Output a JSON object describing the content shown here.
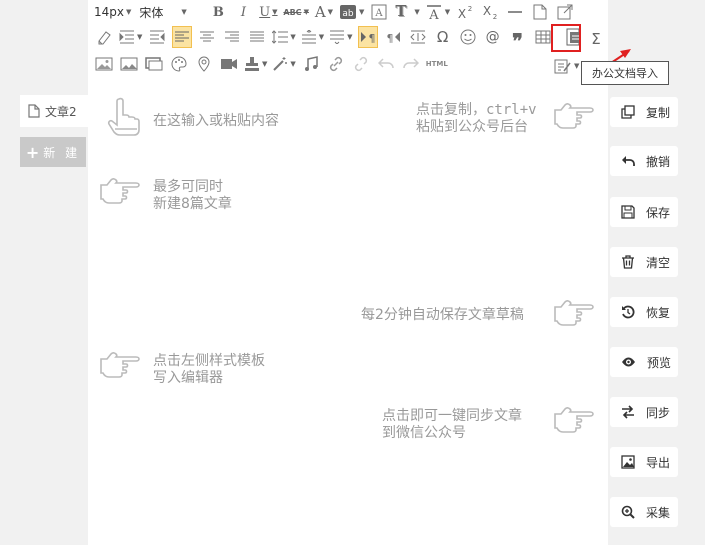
{
  "sidebar": {
    "doc_tab_label": "文章2",
    "new_button_label": "新 建",
    "new_button_plus": "+"
  },
  "toolbar": {
    "font_size": "14px",
    "font_name": "宋体",
    "html_label": "HTML",
    "tooltip": "办公文档导入"
  },
  "hints": {
    "paste": "在这输入或粘贴内容",
    "copy_line1": "点击复制，ctrl+v",
    "copy_line2": "粘贴到公众号后台",
    "max_line1": "最多可同时",
    "max_line2": "新建8篇文章",
    "autosave": "每2分钟自动保存文章草稿",
    "template_line1": "点击左侧样式模板",
    "template_line2": "写入编辑器",
    "sync_line1": "点击即可一键同步文章",
    "sync_line2": "到微信公众号"
  },
  "actions": [
    {
      "label": "复制",
      "icon": "copy-icon"
    },
    {
      "label": "撤销",
      "icon": "undo-icon"
    },
    {
      "label": "保存",
      "icon": "save-icon"
    },
    {
      "label": "清空",
      "icon": "trash-icon"
    },
    {
      "label": "恢复",
      "icon": "restore-icon"
    },
    {
      "label": "预览",
      "icon": "eye-icon"
    },
    {
      "label": "同步",
      "icon": "sync-icon"
    },
    {
      "label": "导出",
      "icon": "image-icon"
    },
    {
      "label": "采集",
      "icon": "search-plus-icon"
    }
  ],
  "colors": {
    "highlight_border": "#e02020",
    "active_button": "#fbe3a2",
    "hint_text": "#999999"
  }
}
